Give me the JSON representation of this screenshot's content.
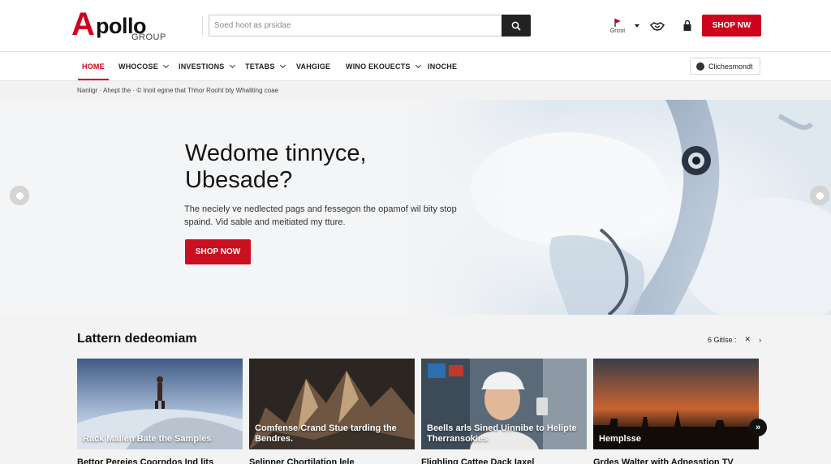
{
  "brand": {
    "letter": "A",
    "word": "pollo",
    "sub": "GROUP",
    "accent": "#d0021b"
  },
  "search": {
    "placeholder": "Soed hoot as prsidae"
  },
  "utilities": {
    "store_label": "Grcist"
  },
  "header": {
    "shop_button": "SHOP NW"
  },
  "nav": {
    "items": [
      {
        "label": "HOME",
        "active": true
      },
      {
        "label": "WHOCOSE",
        "dropdown": true
      },
      {
        "label": "INVESTIONS",
        "dropdown": true
      },
      {
        "label": "TETABS",
        "dropdown": true
      },
      {
        "label": "VAHGIGE"
      },
      {
        "label": "WINO EKOUECTS",
        "dropdown": true
      },
      {
        "label": "INOCHE"
      }
    ],
    "right_button": "Clichesmondt"
  },
  "breadcrumb": "Nanligr · Ahept the · © Inoit egine that Thhor Rooht bty Whaliting coae",
  "hero": {
    "title_line1": "Wedome tinnyce,",
    "title_line2": "Ubesade?",
    "desc": "The neciely ve nedlected pags and fessegon the opamof wil bity stop spaind. Vid sable and meitiated my tture.",
    "button": "SHOP NOW"
  },
  "latest": {
    "title": "Lattern dedeomiam",
    "meta": "6 Gitlse :",
    "cards": [
      {
        "caption": "Rack Mallen Bate the Samples",
        "subtitle": "Bettor Pereies Coorndos Ind lits"
      },
      {
        "caption": "Comfense Crand Stue tarding the Bendres.",
        "subtitle": "Selinner Chortilation lele"
      },
      {
        "caption": "Beells arls Sined Uinnibe to Helipte Therransokies",
        "subtitle": "Flighling Cattee Dack Iaxel"
      },
      {
        "caption": "Hemplsse",
        "subtitle": "Grdes Walter with Adnesstion TV"
      }
    ]
  }
}
